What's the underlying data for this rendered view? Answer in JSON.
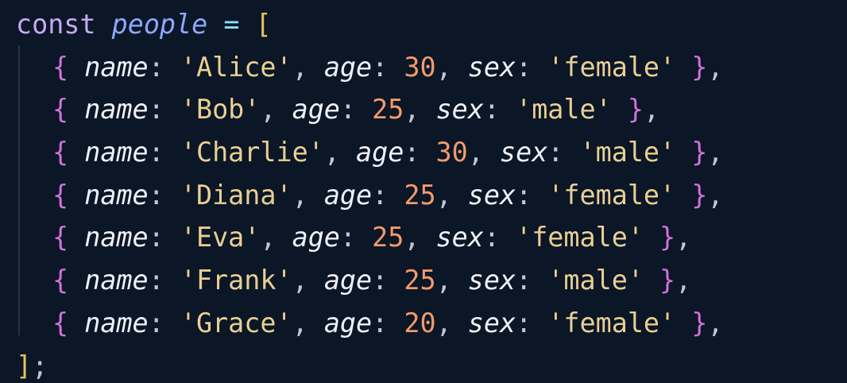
{
  "code": {
    "keyword": "const",
    "variable": "people",
    "assign": "=",
    "open_bracket": "[",
    "close_bracket": "]",
    "semicolon": ";",
    "entries": [
      {
        "name": "'Alice'",
        "age": "30",
        "sex": "'female'"
      },
      {
        "name": "'Bob'",
        "age": "25",
        "sex": "'male'"
      },
      {
        "name": "'Charlie'",
        "age": "30",
        "sex": "'male'"
      },
      {
        "name": "'Diana'",
        "age": "25",
        "sex": "'female'"
      },
      {
        "name": "'Eva'",
        "age": "25",
        "sex": "'female'"
      },
      {
        "name": "'Frank'",
        "age": "25",
        "sex": "'male'"
      },
      {
        "name": "'Grace'",
        "age": "20",
        "sex": "'female'"
      }
    ],
    "keys": {
      "name": "name",
      "age": "age",
      "sex": "sex"
    },
    "brace_open": "{",
    "brace_close": "}",
    "colon": ":",
    "comma": ","
  },
  "colors": {
    "background": "#0b1626",
    "keyword": "#c9a8f0",
    "variable": "#8fa6ff",
    "string": "#e8cf93",
    "number": "#f29a6b",
    "brace": "#d070d8",
    "bracket": "#e6c15a"
  }
}
